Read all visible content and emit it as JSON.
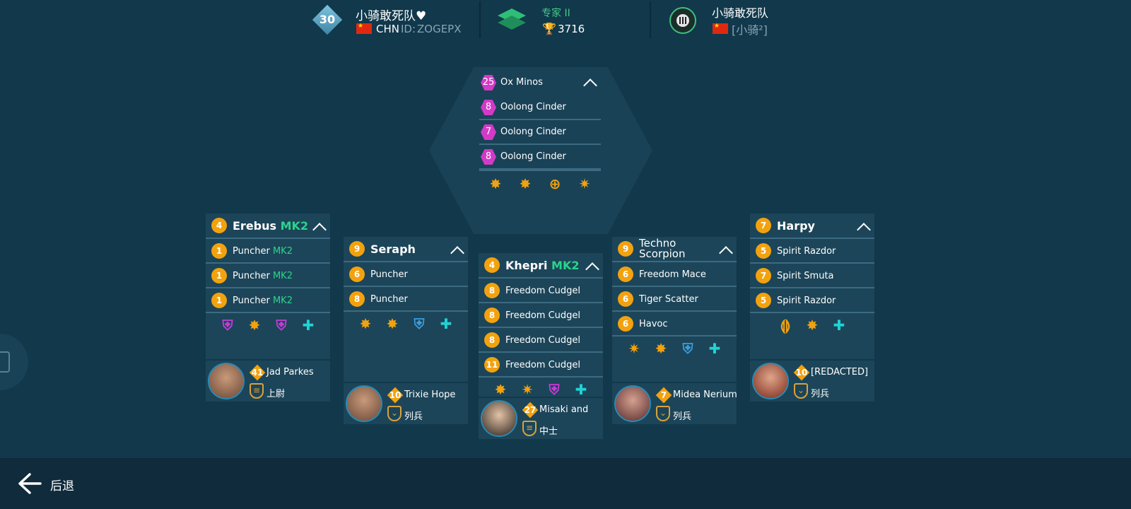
{
  "header": {
    "level": "30",
    "player_name": "小骑敢死队♥",
    "country": "CHN",
    "id_label": "ID:",
    "id_value": "ZOGEPX",
    "league_name": "专家 II",
    "trophies": "3716",
    "clan_name": "小骑敢死队",
    "clan_tag": "[小骑²]"
  },
  "top_bot": {
    "level": "25",
    "name": "Ox Minos",
    "weapons": [
      {
        "level": "8",
        "name": "Oolong Cinder"
      },
      {
        "level": "7",
        "name": "Oolong Cinder"
      },
      {
        "level": "8",
        "name": "Oolong Cinder"
      }
    ],
    "modules": [
      "burst-icon",
      "burst-icon",
      "target-icon",
      "repair-icon"
    ]
  },
  "bots": [
    {
      "level": "4",
      "name": "Erebus",
      "mk": "MK2",
      "weapons": [
        {
          "level": "1",
          "name": "Puncher",
          "mk": "MK2"
        },
        {
          "level": "1",
          "name": "Puncher",
          "mk": "MK2"
        },
        {
          "level": "1",
          "name": "Puncher",
          "mk": "MK2"
        }
      ],
      "modules": [
        "shield-icon",
        "burst-icon",
        "shield-icon",
        "heal-icon"
      ],
      "pilot": {
        "level": "41",
        "name": "Jad Parkes",
        "rank": "上尉"
      }
    },
    {
      "level": "9",
      "name": "Seraph",
      "mk": "",
      "weapons": [
        {
          "level": "6",
          "name": "Puncher",
          "mk": ""
        },
        {
          "level": "8",
          "name": "Puncher",
          "mk": ""
        }
      ],
      "modules": [
        "burst-icon",
        "burst-icon",
        "shield-icon",
        "heal-icon"
      ],
      "pilot": {
        "level": "10",
        "name": "Trixie Hope",
        "rank": "列兵"
      }
    },
    {
      "level": "4",
      "name": "Khepri",
      "mk": "MK2",
      "weapons": [
        {
          "level": "8",
          "name": "Freedom Cudgel",
          "mk": ""
        },
        {
          "level": "8",
          "name": "Freedom Cudgel",
          "mk": ""
        },
        {
          "level": "8",
          "name": "Freedom Cudgel",
          "mk": ""
        },
        {
          "level": "11",
          "name": "Freedom Cudgel",
          "mk": ""
        }
      ],
      "modules": [
        "burst-icon",
        "repair-icon",
        "shield-icon",
        "heal-icon"
      ],
      "pilot": {
        "level": "27",
        "name": "Misaki and",
        "rank": "中士"
      }
    },
    {
      "level": "9",
      "name": "Techno Scorpion",
      "mk": "",
      "weapons": [
        {
          "level": "6",
          "name": "Freedom Mace",
          "mk": ""
        },
        {
          "level": "6",
          "name": "Tiger Scatter",
          "mk": ""
        },
        {
          "level": "6",
          "name": "Havoc",
          "mk": ""
        }
      ],
      "modules": [
        "repair-icon",
        "burst-icon",
        "shield-icon",
        "heal-icon"
      ],
      "pilot": {
        "level": "7",
        "name": "Midea Nerium",
        "rank": "列兵"
      }
    },
    {
      "level": "7",
      "name": "Harpy",
      "mk": "",
      "weapons": [
        {
          "level": "5",
          "name": "Spirit Razdor",
          "mk": ""
        },
        {
          "level": "7",
          "name": "Spirit Smuta",
          "mk": ""
        },
        {
          "level": "5",
          "name": "Spirit Razdor",
          "mk": ""
        }
      ],
      "modules": [
        "armor-icon",
        "burst-icon",
        "heal-icon"
      ],
      "pilot": {
        "level": "10",
        "name": "[REDACTED]",
        "rank": "列兵"
      }
    }
  ],
  "footer": {
    "back_label": "后退"
  },
  "colors": {
    "background": "#11384b",
    "panel": "#1c4559",
    "level_pill": "#f2a20f",
    "hex_level": "#d33ac8",
    "mk_green": "#29d58a",
    "league_green": "#48c98a"
  }
}
